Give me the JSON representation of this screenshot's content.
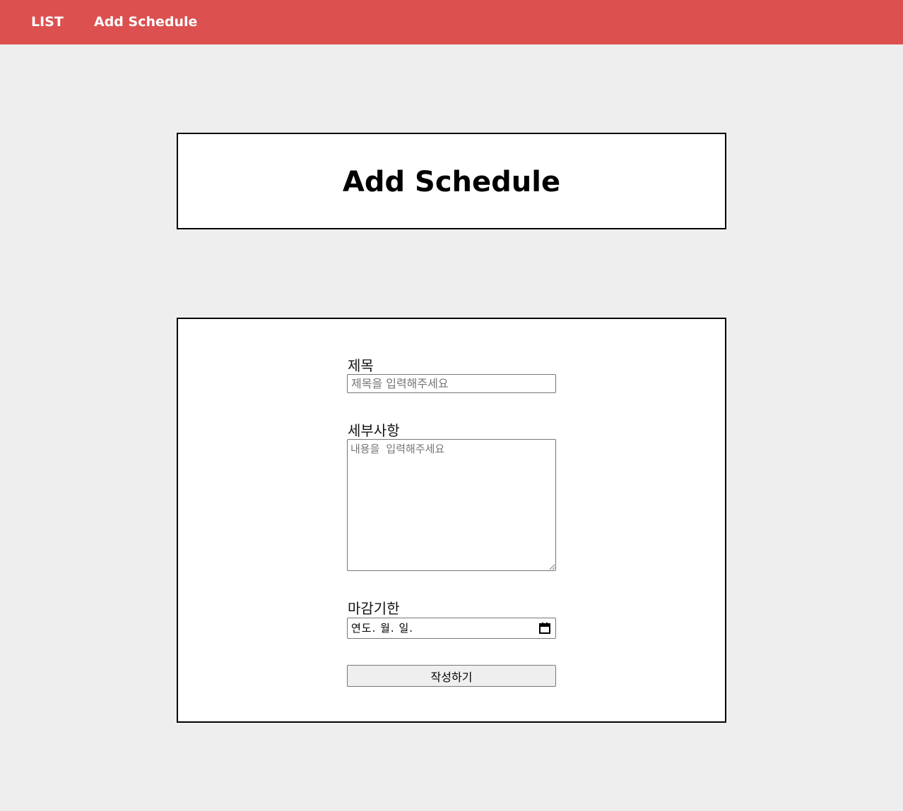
{
  "nav": {
    "list_label": "LIST",
    "add_label": "Add Schedule"
  },
  "header": {
    "title": "Add Schedule"
  },
  "form": {
    "title_label": "제목",
    "title_placeholder": "제목을 입력해주세요",
    "title_value": "",
    "detail_label": "세부사항",
    "detail_placeholder": "내용을 입력해주세요",
    "detail_value": "",
    "deadline_label": "마감기한",
    "deadline_placeholder": "연도. 월. 일.",
    "submit_label": "작성하기"
  },
  "colors": {
    "navbar": "#dc5050",
    "background": "#eeeeee"
  }
}
